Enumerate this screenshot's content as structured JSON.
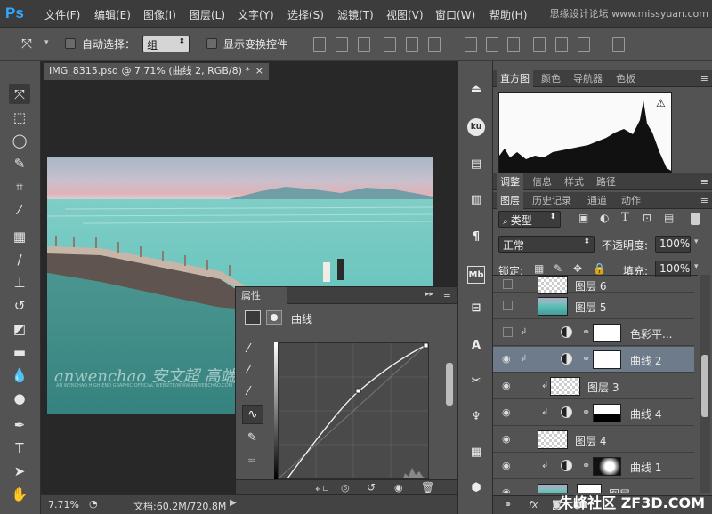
{
  "app": {
    "logo": "Ps"
  },
  "menu": [
    "文件(F)",
    "编辑(E)",
    "图像(I)",
    "图层(L)",
    "文字(Y)",
    "选择(S)",
    "滤镜(T)",
    "视图(V)",
    "窗口(W)",
    "帮助(H)"
  ],
  "top_watermark": "思缘设计论坛 www.missyuan.com",
  "options": {
    "auto_select_label": "自动选择：",
    "group_value": "组",
    "show_transform_label": "显示变换控件"
  },
  "document": {
    "tab_title": "IMG_8315.psd @ 7.71% (曲线 2, RGB/8) *",
    "close": "×",
    "zoom": "7.71%",
    "doc_info": "文档:60.2M/720.8M",
    "watermark_logo": "anwenchao 安文超 高端修图",
    "watermark_small": "AN WENCHAO HIGH-END GRAPHIC OFFICIAL WEBSITE/WWW.ANWENCHAO.COM"
  },
  "properties": {
    "tab": "属性",
    "type": "曲线"
  },
  "panels": {
    "top_tabs": [
      "直方图",
      "颜色",
      "导航器",
      "色板"
    ],
    "mid_tabs": [
      "调整",
      "信息",
      "样式",
      "路径"
    ],
    "layer_tabs": [
      "图层",
      "历史记录",
      "通道",
      "动作"
    ],
    "filter_kind": "类型",
    "blend_mode": "正常",
    "opacity_label": "不透明度:",
    "opacity_value": "100%",
    "lock_label": "锁定:",
    "fill_label": "填充:",
    "fill_value": "100%"
  },
  "layers": [
    {
      "name": "图层 6"
    },
    {
      "name": "图层 5"
    },
    {
      "name": "色彩平..."
    },
    {
      "name": "曲线 2"
    },
    {
      "name": "图层 3"
    },
    {
      "name": "曲线 4"
    },
    {
      "name": "图层 4"
    },
    {
      "name": "曲线 1"
    },
    {
      "name": "图层"
    }
  ],
  "footer_watermark": "朱峰社区 ZF3D.COM"
}
